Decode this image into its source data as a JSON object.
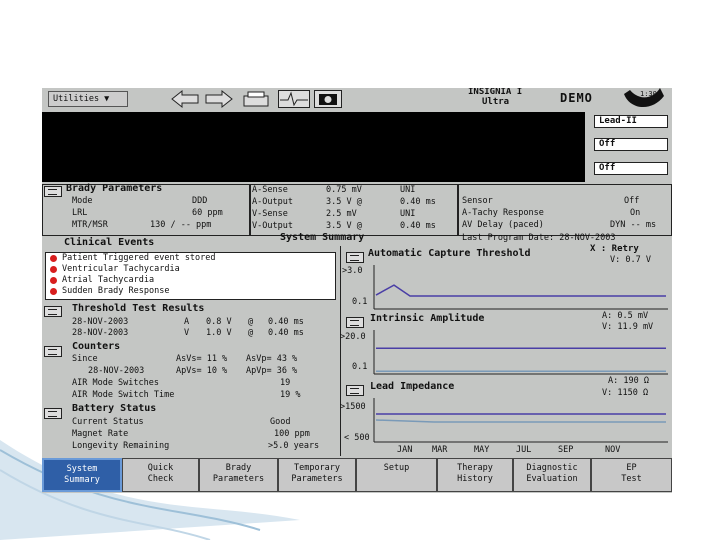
{
  "device": {
    "name_line1": "INSIGNIA I",
    "name_line2": "Ultra",
    "demo_label": "DEMO",
    "counter": "1:30"
  },
  "toolbar": {
    "utilities_label": "Utilities ▼"
  },
  "lead_buttons": [
    "Lead-II",
    "Off",
    "Off"
  ],
  "brady": {
    "title": "Brady Parameters",
    "rows": [
      {
        "label": "Mode",
        "value": "DDD"
      },
      {
        "label": "LRL",
        "value": "60 ppm"
      },
      {
        "label": "MTR/MSR",
        "value": "130  /  -- ppm"
      }
    ],
    "middle": [
      {
        "label": "A-Sense",
        "value": "0.75 mV",
        "extra": "UNI"
      },
      {
        "label": "A-Output",
        "value": "3.5 V  @",
        "extra": "0.40 ms"
      },
      {
        "label": "V-Sense",
        "value": "2.5 mV",
        "extra": "UNI"
      },
      {
        "label": "V-Output",
        "value": "3.5 V  @",
        "extra": "0.40 ms"
      }
    ],
    "right": [
      {
        "label": "Sensor",
        "value": "Off"
      },
      {
        "label": "A-Tachy Response",
        "value": "On"
      },
      {
        "label": "AV Delay (paced)",
        "value": "DYN -- ms"
      }
    ]
  },
  "summary": {
    "title": "System Summary",
    "last_program": "Last Program Date: 28-NOV-2003"
  },
  "clinical": {
    "title": "Clinical Events",
    "events": [
      "Patient Triggered event stored",
      "Ventricular Tachycardia",
      "Atrial Tachycardia",
      "Sudden Brady Response"
    ]
  },
  "threshold": {
    "title": "Threshold Test Results",
    "rows": [
      {
        "date": "28-NOV-2003",
        "ch": "A",
        "val": "0.8 V",
        "at": "@",
        "pw": "0.40 ms"
      },
      {
        "date": "28-NOV-2003",
        "ch": "V",
        "val": "1.0 V",
        "at": "@",
        "pw": "0.40 ms"
      }
    ]
  },
  "counters": {
    "title": "Counters",
    "since_label": "Since",
    "since_date": "28-NOV-2003",
    "asvs": "AsVs= 11 %",
    "asvp": "AsVp= 43 %",
    "apvs": "ApVs= 10 %",
    "apvp": "ApVp= 36 %",
    "air_switches_label": "AIR Mode Switches",
    "air_switches_value": "19",
    "air_time_label": "AIR Mode Switch Time",
    "air_time_value": "19 %"
  },
  "battery": {
    "title": "Battery Status",
    "rows": [
      {
        "label": "Current Status",
        "value": "Good"
      },
      {
        "label": "Magnet Rate",
        "value": "100 ppm"
      },
      {
        "label": "Longevity Remaining",
        "value": ">5.0 years"
      }
    ]
  },
  "charts": {
    "capture": {
      "title": "Automatic Capture Threshold",
      "retry": "X : Retry",
      "v_label": "V:  0.7 V",
      "y_top": ">3.0",
      "y_mid": "0.1",
      "y_bottom": "0.1"
    },
    "intrinsic": {
      "title": "Intrinsic Amplitude",
      "a_label": "A:  0.5 mV",
      "v_label": "V: 11.9 mV",
      "y_top": ">20.0",
      "y_bottom": "0.1"
    },
    "impedance": {
      "title": "Lead Impedance",
      "a_label": "A:  190 Ω",
      "v_label": "V: 1150 Ω",
      "y_top": ">1500",
      "y_bottom": "< 500"
    },
    "months": [
      "JAN",
      "MAR",
      "MAY",
      "JUL",
      "SEP",
      "NOV"
    ],
    "colors": {
      "v_series": "#4a3ea6",
      "a_series": "#7a9ab8"
    }
  },
  "chart_data": [
    {
      "type": "line",
      "title": "Automatic Capture Threshold",
      "x": [
        "JAN",
        "MAR",
        "MAY",
        "JUL",
        "SEP",
        "NOV"
      ],
      "series": [
        {
          "name": "V",
          "values": [
            1.4,
            0.9,
            0.9,
            0.9,
            0.9,
            0.9
          ]
        }
      ]
    },
    {
      "type": "line",
      "title": "Intrinsic Amplitude",
      "x": [
        "JAN",
        "MAR",
        "MAY",
        "JUL",
        "SEP",
        "NOV"
      ],
      "series": [
        {
          "name": "A",
          "values": [
            0.5,
            0.5,
            0.5,
            0.5,
            0.5,
            0.5
          ]
        },
        {
          "name": "V",
          "values": [
            11.9,
            11.9,
            11.9,
            11.9,
            11.9,
            11.9
          ]
        }
      ]
    },
    {
      "type": "line",
      "title": "Lead Impedance",
      "x": [
        "JAN",
        "MAR",
        "MAY",
        "JUL",
        "SEP",
        "NOV"
      ],
      "series": [
        {
          "name": "A",
          "values": [
            1150,
            1100,
            1100,
            1100,
            1100,
            1100
          ]
        },
        {
          "name": "V",
          "values": [
            1150,
            1150,
            1150,
            1150,
            1150,
            1150
          ]
        }
      ]
    }
  ],
  "tabs": [
    {
      "line1": "System",
      "line2": "Summary",
      "active": true
    },
    {
      "line1": "Quick",
      "line2": "Check"
    },
    {
      "line1": "Brady",
      "line2": "Parameters"
    },
    {
      "line1": "Temporary",
      "line2": "Parameters"
    },
    {
      "line1": "Setup",
      "line2": ""
    },
    {
      "line1": "Therapy",
      "line2": "History"
    },
    {
      "line1": "Diagnostic",
      "line2": "Evaluation"
    },
    {
      "line1": "EP",
      "line2": "Test"
    }
  ]
}
